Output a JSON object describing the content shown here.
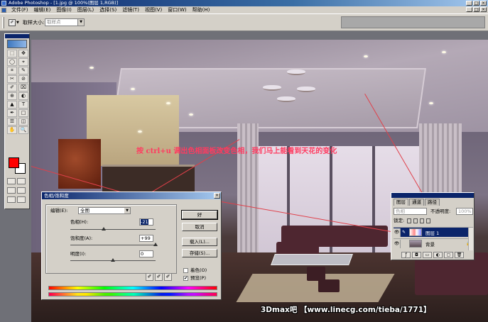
{
  "window": {
    "title": "Adobe Photoshop - [1.jpg @ 100%(图层 1,RGB)]",
    "controls": [
      "_",
      "□",
      "×"
    ]
  },
  "menu": {
    "items": [
      "文件(F)",
      "编辑(E)",
      "图像(I)",
      "图层(L)",
      "选择(S)",
      "滤镜(T)",
      "视图(V)",
      "窗口(W)",
      "帮助(H)"
    ]
  },
  "options_bar": {
    "sample_size_label": "取样大小:",
    "sample_size_value": "取样点"
  },
  "canvas": {
    "annotation": "按 ctrl+u 调出色相面板改变色相，我们马上能看到天花的变化",
    "watermark": "3Dmax吧 【www.linecg.com/tieba/1771】"
  },
  "toolbox": {
    "foreground_color": "#ff0000",
    "background_color": "#ffffff",
    "tools": [
      "⬚",
      "✥",
      "◯",
      "⌖",
      "⌗",
      "✎",
      "✂",
      "⊘",
      "✐",
      "⌧",
      "⊕",
      "◐",
      "▲",
      "T",
      "✒",
      "□",
      "☰",
      "◫",
      "✋",
      "🔍"
    ]
  },
  "hue_sat_dialog": {
    "title": "色相/饱和度",
    "edit_label": "编辑(E):",
    "edit_value": "全图",
    "hue_label": "色相(H):",
    "hue_value": "-21",
    "saturation_label": "饱和度(A):",
    "saturation_value": "+99",
    "lightness_label": "明度(I):",
    "lightness_value": "0",
    "buttons": {
      "ok": "好",
      "cancel": "取消",
      "load": "载入(L)...",
      "save": "存储(S)..."
    },
    "colorize_label": "着色(O)",
    "colorize_checked": false,
    "preview_label": "预览(P)",
    "preview_checked": true
  },
  "layers_panel": {
    "tabs": [
      "图层",
      "通道",
      "路径"
    ],
    "blend_mode": "色相",
    "opacity_label": "不透明度:",
    "opacity_value": "100%",
    "lock_label": "锁定:",
    "layers": [
      {
        "name": "图层 1",
        "selected": true
      },
      {
        "name": "背景",
        "selected": false,
        "locked": true
      }
    ]
  },
  "colors": {
    "title_bar": "#0a246a",
    "chrome": "#d4d0c8",
    "annotation": "#ff3b60"
  }
}
